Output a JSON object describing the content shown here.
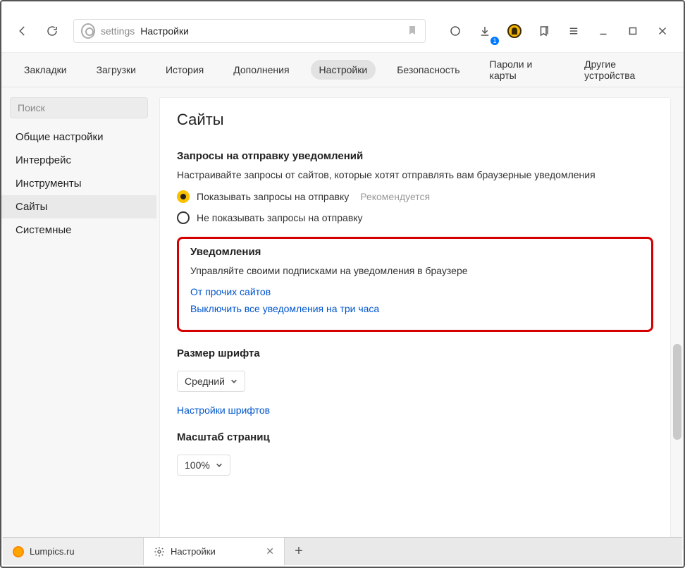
{
  "toolbar": {
    "address_host": "settings",
    "address_title": "Настройки",
    "download_badge": "1"
  },
  "toptabs": {
    "items": [
      {
        "label": "Закладки"
      },
      {
        "label": "Загрузки"
      },
      {
        "label": "История"
      },
      {
        "label": "Дополнения"
      },
      {
        "label": "Настройки",
        "active": true
      },
      {
        "label": "Безопасность"
      },
      {
        "label": "Пароли и карты"
      },
      {
        "label": "Другие устройства"
      }
    ]
  },
  "sidebar": {
    "search_placeholder": "Поиск",
    "items": [
      {
        "label": "Общие настройки"
      },
      {
        "label": "Интерфейс"
      },
      {
        "label": "Инструменты"
      },
      {
        "label": "Сайты",
        "selected": true
      },
      {
        "label": "Системные"
      }
    ]
  },
  "content": {
    "title": "Сайты",
    "requests": {
      "title": "Запросы на отправку уведомлений",
      "desc": "Настраивайте запросы от сайтов, которые хотят отправлять вам браузерные уведомления",
      "option1": "Показывать запросы на отправку",
      "option1_hint": "Рекомендуется",
      "option2": "Не показывать запросы на отправку"
    },
    "notifications": {
      "title": "Уведомления",
      "desc": "Управляйте своими подписками на уведомления в браузере",
      "link1": "От прочих сайтов",
      "link2": "Выключить все уведомления на три часа"
    },
    "font": {
      "title": "Размер шрифта",
      "select_value": "Средний",
      "link": "Настройки шрифтов"
    },
    "scale": {
      "title": "Масштаб страниц",
      "select_value": "100%"
    }
  },
  "browtabs": {
    "tab1": "Lumpics.ru",
    "tab2": "Настройки"
  }
}
